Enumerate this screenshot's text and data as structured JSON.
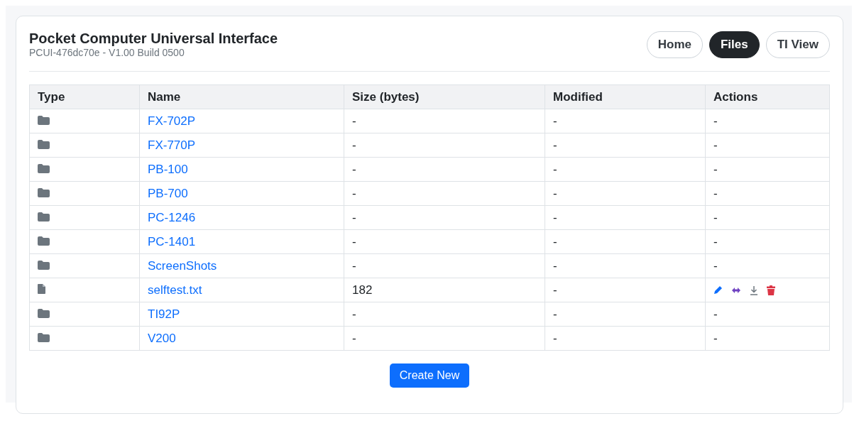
{
  "header": {
    "title": "Pocket Computer Universal Interface",
    "subtitle": "PCUI-476dc70e - V1.00 Build 0500"
  },
  "nav": [
    {
      "label": "Home",
      "selected": false
    },
    {
      "label": "Files",
      "selected": true
    },
    {
      "label": "TI View",
      "selected": false
    }
  ],
  "table": {
    "columns": [
      "Type",
      "Name",
      "Size (bytes)",
      "Modified",
      "Actions"
    ],
    "rows": [
      {
        "kind": "folder",
        "name": "FX-702P",
        "size": "-",
        "modified": "-",
        "actions": "-"
      },
      {
        "kind": "folder",
        "name": "FX-770P",
        "size": "-",
        "modified": "-",
        "actions": "-"
      },
      {
        "kind": "folder",
        "name": "PB-100",
        "size": "-",
        "modified": "-",
        "actions": "-"
      },
      {
        "kind": "folder",
        "name": "PB-700",
        "size": "-",
        "modified": "-",
        "actions": "-"
      },
      {
        "kind": "folder",
        "name": "PC-1246",
        "size": "-",
        "modified": "-",
        "actions": "-"
      },
      {
        "kind": "folder",
        "name": "PC-1401",
        "size": "-",
        "modified": "-",
        "actions": "-"
      },
      {
        "kind": "folder",
        "name": "ScreenShots",
        "size": "-",
        "modified": "-",
        "actions": "-"
      },
      {
        "kind": "file",
        "name": "selftest.txt",
        "size": "182",
        "modified": "-"
      },
      {
        "kind": "folder",
        "name": "TI92P",
        "size": "-",
        "modified": "-",
        "actions": "-"
      },
      {
        "kind": "folder",
        "name": "V200",
        "size": "-",
        "modified": "-",
        "actions": "-"
      }
    ]
  },
  "create_button": "Create New"
}
